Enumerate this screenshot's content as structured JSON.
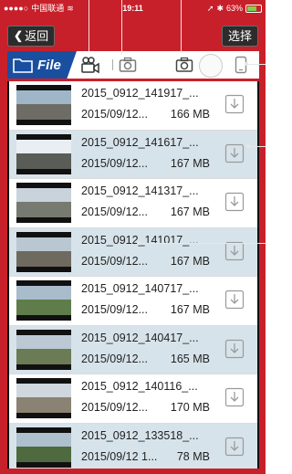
{
  "status_bar": {
    "carrier": "中国联通",
    "time": "19:11",
    "battery": "63%"
  },
  "nav": {
    "back_label": "返回",
    "select_label": "选择"
  },
  "toolbar": {
    "file_label": "File",
    "icons": [
      "folder-icon",
      "video-camera-icon",
      "camera-icon",
      "camera-icon",
      "phone-icon"
    ]
  },
  "files": [
    {
      "name": "2015_0912_141917_...",
      "date": "2015/09/12...",
      "size": "166 MB"
    },
    {
      "name": "2015_0912_141617_...",
      "date": "2015/09/12...",
      "size": "167 MB"
    },
    {
      "name": "2015_0912_141317_...",
      "date": "2015/09/12...",
      "size": "167 MB"
    },
    {
      "name": "2015_0912_141017_...",
      "date": "2015/09/12...",
      "size": "167 MB"
    },
    {
      "name": "2015_0912_140717_...",
      "date": "2015/09/12...",
      "size": "167 MB"
    },
    {
      "name": "2015_0912_140417_...",
      "date": "2015/09/12...",
      "size": "165 MB"
    },
    {
      "name": "2015_0912_140116_...",
      "date": "2015/09/12...",
      "size": "170 MB"
    },
    {
      "name": "2015_0912_133518_...",
      "date": "2015/09/12 1...",
      "size": "78 MB"
    }
  ],
  "colors": {
    "frame": "#c8202a",
    "file_tab": "#1a4fa0",
    "row_alt": "#d7e3ea"
  }
}
